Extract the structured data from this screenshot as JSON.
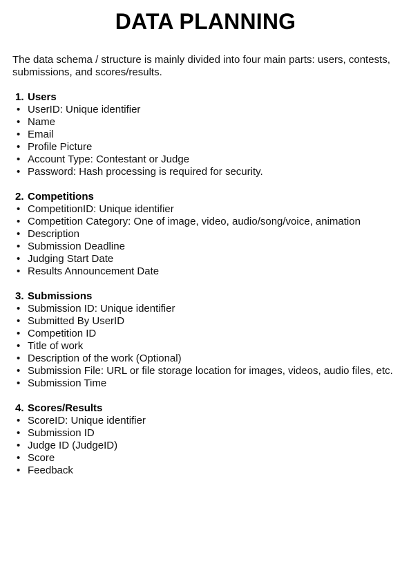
{
  "document": {
    "title": "DATA PLANNING",
    "intro": "The data schema / structure is mainly divided into four main parts: users, contests, submissions, and scores/results.",
    "bullet_char": "•",
    "sections": [
      {
        "number": "1.",
        "heading": "Users",
        "items": [
          "UserID: Unique identifier",
          "Name",
          "Email",
          "Profile Picture",
          "Account Type: Contestant or Judge",
          "Password: Hash processing is required for security."
        ]
      },
      {
        "number": "2.",
        "heading": "Competitions",
        "items": [
          "CompetitionID: Unique identifier",
          "Competition Category: One of image, video, audio/song/voice, animation",
          "Description",
          "Submission Deadline",
          "Judging Start Date",
          "Results Announcement Date"
        ]
      },
      {
        "number": "3.",
        "heading": "Submissions",
        "items": [
          "Submission ID: Unique identifier",
          "Submitted By UserID",
          "Competition ID",
          "Title of work",
          "Description of the work (Optional)",
          "Submission File: URL or file storage location for images, videos, audio files, etc.",
          "Submission Time"
        ]
      },
      {
        "number": "4.",
        "heading": "Scores/Results",
        "items": [
          "ScoreID: Unique identifier",
          "Submission ID",
          "Judge ID (JudgeID)",
          "Score",
          "Feedback"
        ]
      }
    ]
  }
}
